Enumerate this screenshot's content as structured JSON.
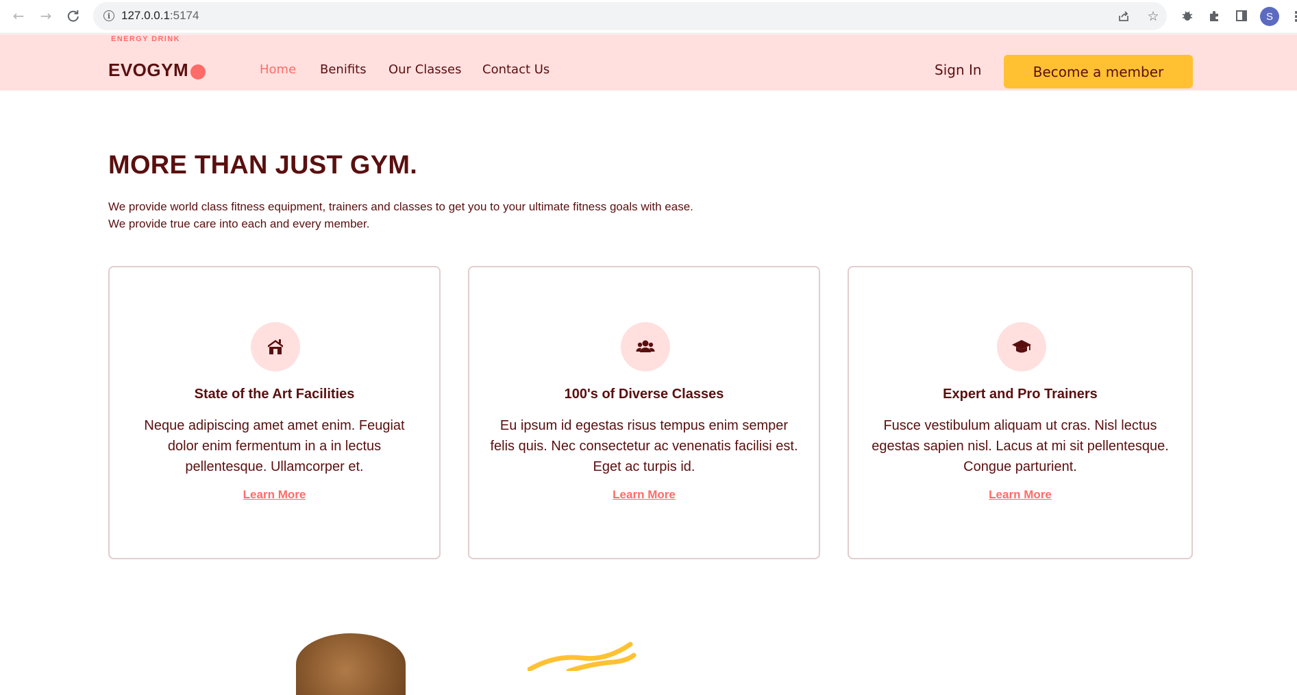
{
  "browser": {
    "url_host": "127.0.0.1",
    "url_port": ":5174",
    "profile_initial": "S"
  },
  "navbar": {
    "logo_subtitle": "ENERGY DRINK",
    "logo_text": "EVOGYM",
    "links": [
      {
        "label": "Home",
        "active": true
      },
      {
        "label": "Benifits",
        "active": false
      },
      {
        "label": "Our Classes",
        "active": false
      },
      {
        "label": "Contact Us",
        "active": false
      }
    ],
    "sign_in": "Sign In",
    "cta": "Become a member"
  },
  "hero": {
    "title": "MORE THAN JUST GYM.",
    "desc_line1": "We provide world class fitness equipment, trainers and classes to get you to your ultimate fitness goals with ease.",
    "desc_line2": "We provide true care into each and every member."
  },
  "cards": [
    {
      "icon": "home-icon",
      "title": "State of the Art Facilities",
      "text": "Neque adipiscing amet amet enim. Feugiat dolor enim fermentum in a in lectus pellentesque. Ullamcorper et.",
      "link": "Learn More"
    },
    {
      "icon": "users-icon",
      "title": "100's of Diverse Classes",
      "text": "Eu ipsum id egestas risus tempus enim semper felis quis. Nec consectetur ac venenatis facilisi est. Eget ac turpis id.",
      "link": "Learn More"
    },
    {
      "icon": "graduation-cap-icon",
      "title": "Expert and Pro Trainers",
      "text": "Fusce vestibulum aliquam ut cras. Nisl lectus egestas sapien nisl. Lacus at mi sit pellentesque. Congue parturient.",
      "link": "Learn More"
    }
  ],
  "colors": {
    "primary": "#5a0f0f",
    "accent": "#ff6b66",
    "nav_bg": "#ffe0df",
    "cta": "#ffc132"
  }
}
